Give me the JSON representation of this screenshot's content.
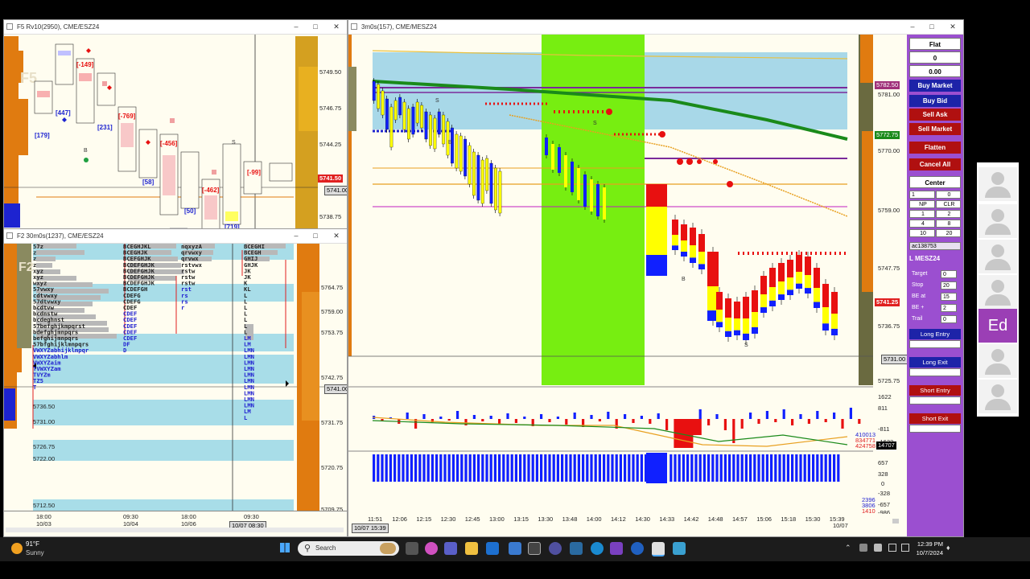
{
  "win_f5": {
    "title": "F5 Rv10(2950), CME/ESZ24",
    "prices": [
      "5749.50",
      "5746.75",
      "5744.25",
      "5741.50",
      "5741.00",
      "5738.75"
    ],
    "current_price": "5741.50",
    "bracket_labels": [
      "[-149]",
      "[447]",
      "[179]",
      "[231]",
      "[-769]",
      "[-456]",
      "[58]",
      "[50]",
      "[-462]",
      "[719]",
      "[-99]"
    ],
    "b_label": "B",
    "s_label": "S"
  },
  "win_f2": {
    "title": "F2 30m0s(1237), CME/ESZ24",
    "prices": [
      "5764.75",
      "5759.00",
      "5753.75",
      "5742.75",
      "5741.00",
      "5731.75",
      "5720.75",
      "5709.75"
    ],
    "level_labels": [
      "5736.50",
      "5731.00",
      "5726.75",
      "5722.00",
      "5712.50"
    ],
    "date_labels": [
      {
        "time": "18:00",
        "date": "10/03"
      },
      {
        "time": "09:30",
        "date": "10/04"
      },
      {
        "time": "18:00",
        "date": "10/06"
      },
      {
        "time": "09:30",
        "date": "10/07"
      }
    ],
    "cursor_date": "10/07 08:30",
    "letters_col1": [
      "57z",
      "z",
      "z",
      "z",
      "xyz",
      "xyz",
      "wxyz",
      "57vwxy",
      "cdtvwxy",
      "57dtvwxy",
      "bcdtvw",
      "bcdnstw",
      "bcdeghnst",
      "57befghjkmpqrst",
      "bdefghjmnpqrs",
      "befghijmnpqrs",
      "57bfghijklmnpqrs",
      "VWXYZabhijklmpqr",
      "VWXYZabhlm",
      "VWXYZaim",
      "TVWXYZam",
      "TVYZm",
      "TZ5",
      "T"
    ],
    "letters_col2": [
      "BCEGHJKL",
      "BCEGHJK",
      "BCEFGHJK",
      "BCDEFGHJK",
      "BCDEFGHJK",
      "BCDEFGHJK",
      "BCDEFGHJK",
      "BCDEFGH",
      "CDEFG",
      "CDEFG",
      "CDEF",
      "CDEF",
      "CDEF",
      "CDEF",
      "CDEF",
      "CDEF",
      "DF",
      "D"
    ],
    "letters_col3": [
      "nqxyzA",
      "qrvwxy",
      "qrvwx",
      "rstvwx",
      "rstw",
      "rstw",
      "rstw",
      "rst",
      "rs",
      "rs",
      "r"
    ],
    "letters_col4": [
      "BCEGHI",
      "BCEGH",
      "GHIJ",
      "GHJK",
      "JK",
      "JK",
      "K",
      "KL",
      "L",
      "L",
      "L",
      "L",
      "L",
      "L",
      "L",
      "LM",
      "LM",
      "LMN",
      "LMN",
      "LMN",
      "LMN",
      "LMN",
      "LMN",
      "LMN",
      "LMN",
      "LMN",
      "LMN",
      "LM",
      "L"
    ]
  },
  "win_main": {
    "title": "3m0s(157), CME/MESZ24",
    "prices": [
      "5781.00",
      "5770.00",
      "5759.00",
      "5747.75",
      "5736.75",
      "5725.75"
    ],
    "price_tags": [
      {
        "text": "5782.50",
        "color": "#a0307a"
      },
      {
        "text": "5772.75",
        "color": "#1a8a1a"
      },
      {
        "text": "5741.25",
        "color": "#e02020"
      },
      {
        "text": "5731.00",
        "color": "#dddddd"
      }
    ],
    "delta_scale": [
      "1622",
      "811",
      "-811",
      "-1622"
    ],
    "delta_values": [
      {
        "text": "410013",
        "color": "#2020d0"
      },
      {
        "text": "834771",
        "color": "#e02020"
      },
      {
        "text": "424758",
        "color": "#e02020"
      },
      {
        "text": "14707",
        "color": "#ffffff"
      }
    ],
    "vol_scale": [
      "657",
      "328",
      "0",
      "-328",
      "-657",
      "-986"
    ],
    "vol_values": [
      "2396",
      "3806",
      "1410"
    ],
    "time_labels": [
      "11:51",
      "12:06",
      "12:15",
      "12:30",
      "12:45",
      "13:00",
      "13:15",
      "13:30",
      "13:48",
      "14:00",
      "14:12",
      "14:30",
      "14:33",
      "14:42",
      "14:48",
      "14:57",
      "15:06",
      "15:18",
      "15:30",
      "15:39"
    ],
    "time_date": "10/07",
    "cursor_time": "10/07 15:39",
    "b_label": "B",
    "s_label": "S"
  },
  "dom": {
    "position": "Flat",
    "qty": "0",
    "pnl": "0.00",
    "buy_market": "Buy Market",
    "buy_bid": "Buy Bid",
    "sell_ask": "Sell Ask",
    "sell_market": "Sell Market",
    "flatten": "Flatten",
    "cancel_all": "Cancel All",
    "center": "Center",
    "qty_input": "1",
    "qty_right": "0",
    "np": "NP",
    "clr": "CLR",
    "presets": [
      [
        "1",
        "2"
      ],
      [
        "4",
        "8"
      ],
      [
        "10",
        "20"
      ]
    ],
    "account": "ac138753",
    "instrument": "L MESZ24",
    "params": [
      {
        "label": "Target",
        "value": "0"
      },
      {
        "label": "Stop",
        "value": "20"
      },
      {
        "label": "BE at",
        "value": "15"
      },
      {
        "label": "BE +",
        "value": "2"
      },
      {
        "label": "Trail",
        "value": "0"
      }
    ],
    "long_entry": "Long Entry",
    "long_exit": "Long Exit",
    "short_entry": "Short Entry",
    "short_exit": "Short Exit"
  },
  "participants": {
    "active_initials": "Ed",
    "active_color": "#9b3fb5"
  },
  "taskbar": {
    "weather_temp": "91°F",
    "weather_cond": "Sunny",
    "search_placeholder": "Search",
    "time": "12:39 PM",
    "date": "10/7/2024"
  },
  "colors": {
    "up_candle": "#ffff00",
    "down_candle": "#1020ff",
    "sell_red": "#e81010",
    "highlight_green": "#77ee11",
    "value_area": "#a8d8e8"
  }
}
